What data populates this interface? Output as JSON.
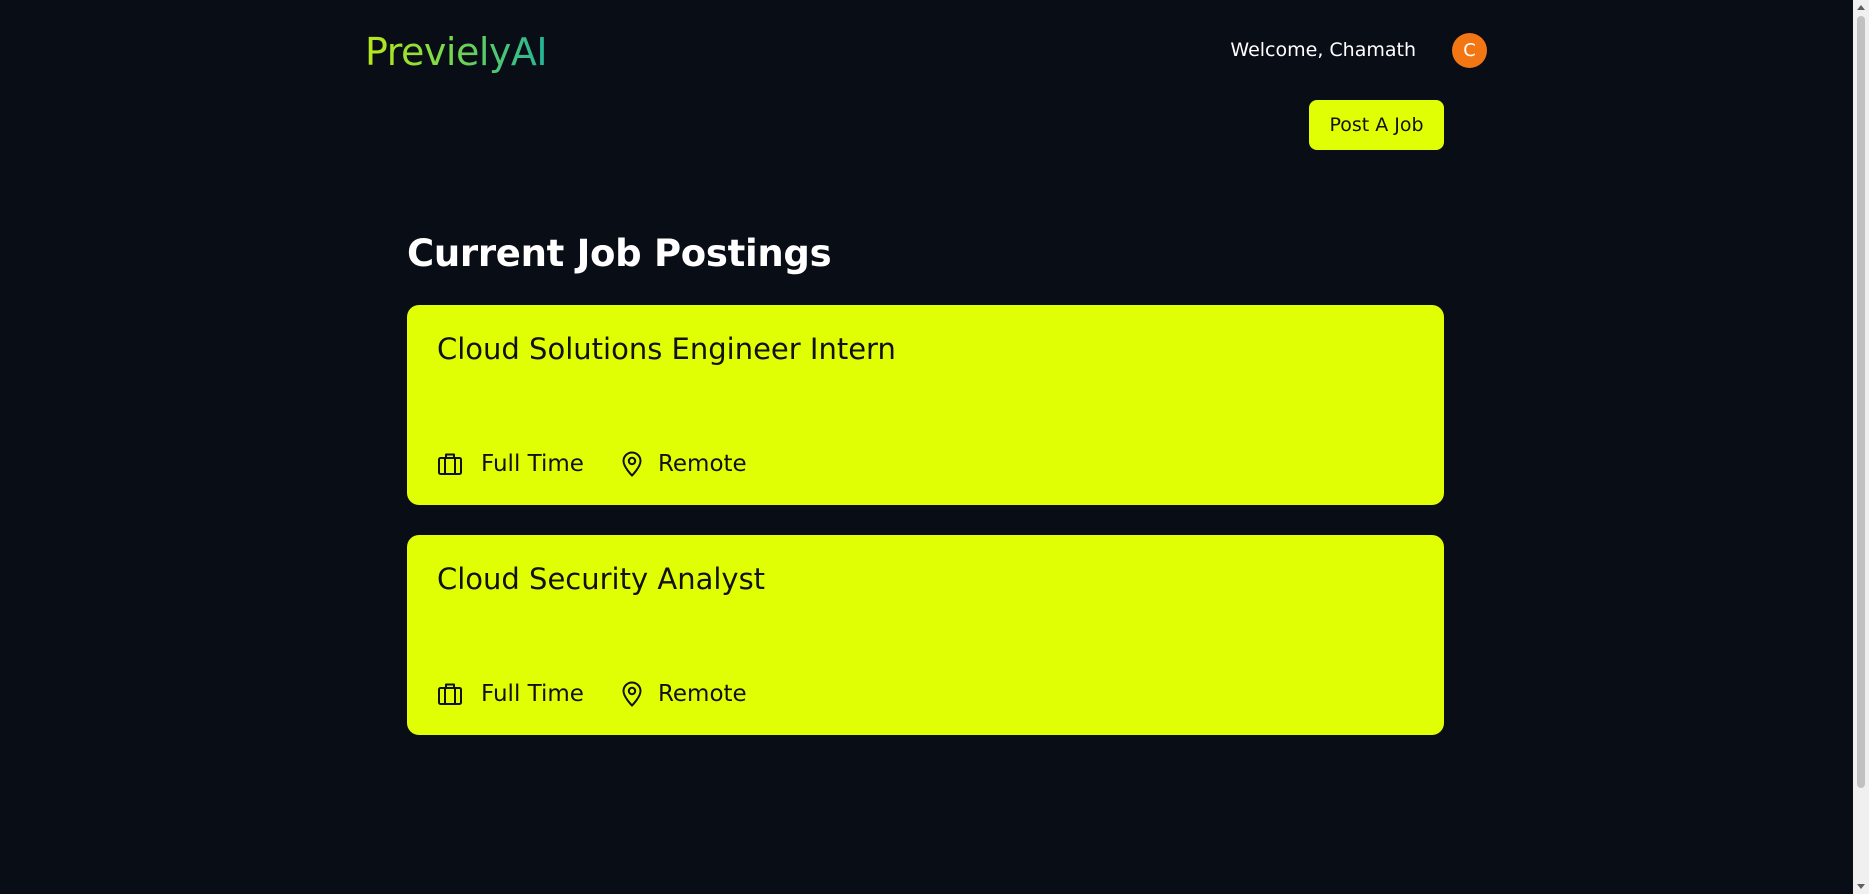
{
  "header": {
    "logo_text": "PrevielyAI",
    "welcome_text": "Welcome, Chamath",
    "avatar_initial": "C",
    "post_job_label": "Post A Job"
  },
  "main": {
    "section_title": "Current Job Postings",
    "jobs": [
      {
        "title": "Cloud Solutions Engineer Intern",
        "employment_type": "Full Time",
        "location": "Remote"
      },
      {
        "title": "Cloud Security Analyst",
        "employment_type": "Full Time",
        "location": "Remote"
      }
    ]
  },
  "icons": {
    "employment_type": "briefcase-icon",
    "location": "map-pin-icon"
  },
  "colors": {
    "background": "#090d16",
    "accent": "#e0ff05",
    "avatar": "#f27614",
    "logo_gradient_start": "#b9e81a",
    "logo_gradient_end": "#22b59a"
  }
}
